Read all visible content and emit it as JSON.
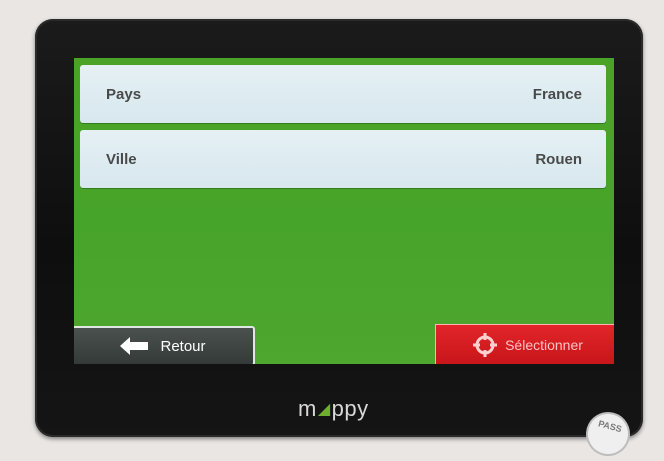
{
  "form": {
    "pays_label": "Pays",
    "pays_value": "France",
    "ville_label": "Ville",
    "ville_value": "Rouen"
  },
  "buttons": {
    "back_label": "Retour",
    "back_icon": "arrow-left-icon",
    "select_label": "Sélectionner",
    "select_icon": "crosshair-icon"
  },
  "device": {
    "brand": "mappy",
    "sticker_text": "PASS"
  },
  "colors": {
    "screen_background": "#4aa326",
    "row_background": "#e0eef3",
    "back_button": "#3d4341",
    "select_button": "#d81e22",
    "brand_accent": "#6fae2f"
  }
}
